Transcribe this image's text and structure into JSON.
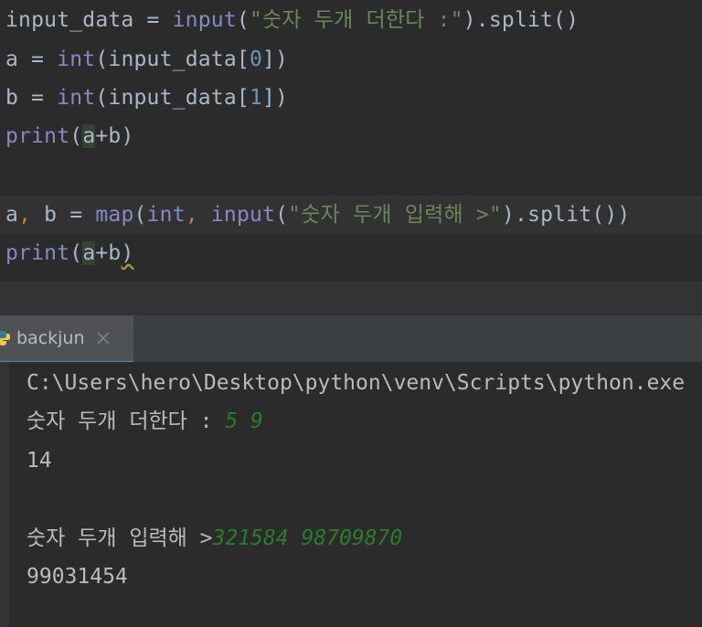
{
  "editor": {
    "line1": {
      "a": "input_data = ",
      "b": "input",
      "c": "(",
      "d": "\"숫자 두개 더한다 :\"",
      "e": ").split()"
    },
    "line2": {
      "a": "a = ",
      "b": "int",
      "c": "(input_data[",
      "d": "0",
      "e": "])"
    },
    "line3": {
      "a": "b = ",
      "b": "int",
      "c": "(input_data[",
      "d": "1",
      "e": "])"
    },
    "line4": {
      "a": "print",
      "b": "(",
      "c": "a",
      "d": "+b)"
    },
    "line6": {
      "a": "a",
      "b": ", ",
      "c": "b = ",
      "d": "map",
      "e": "(",
      "f": "int",
      "g": ", ",
      "h": "input",
      "i": "(",
      "j": "\"숫자 두개 입력해 >\"",
      "k": ").split())"
    },
    "line7": {
      "a": "print",
      "b": "(",
      "c": "a",
      "d": "+b",
      "e": ")"
    }
  },
  "run_panel": {
    "tab_label": "backjun",
    "icons": {
      "tab": "python-icon",
      "close": "close-icon"
    }
  },
  "console": {
    "path": "C:\\Users\\hero\\Desktop\\python\\venv\\Scripts\\python.exe",
    "prompt1": "숫자 두개 더한다 : ",
    "input1": "5 9",
    "output1": "14",
    "prompt2": "숫자 두개 입력해 >",
    "input2": "321584 98709870",
    "output2": "99031454"
  },
  "colors": {
    "editor_bg": "#2b2b2b",
    "builtin": "#8888c6",
    "string": "#6a8759",
    "number": "#6897bb",
    "keyword_punct": "#cc7832",
    "user_input": "#287d2c",
    "tab_accent": "#4a88c7"
  }
}
